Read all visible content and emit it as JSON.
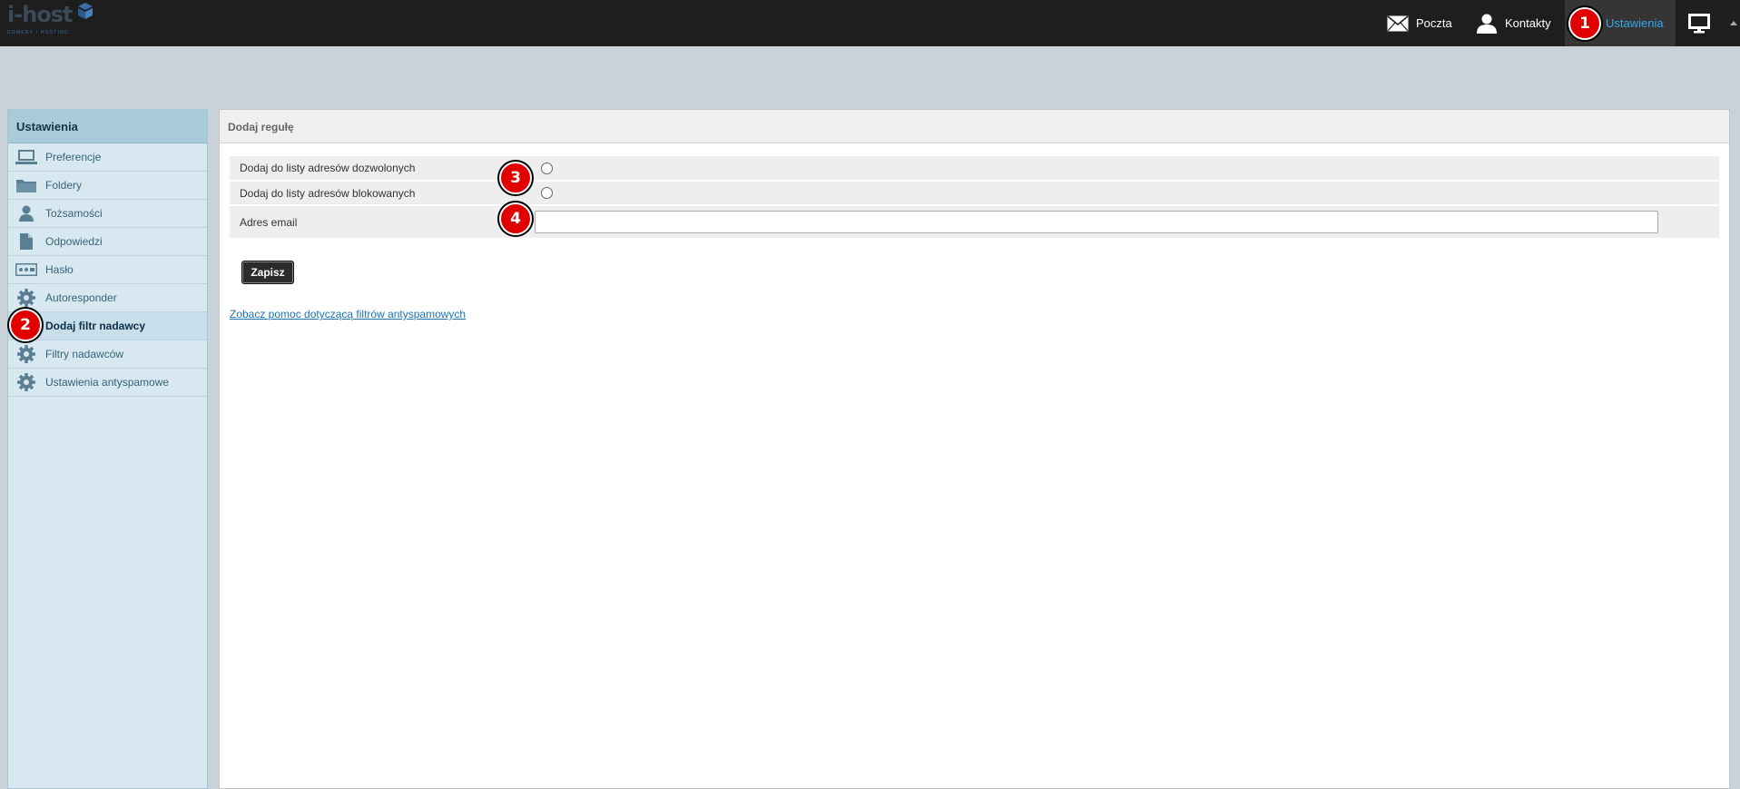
{
  "brand": {
    "name": "i-host",
    "tagline": "DOMENY I HOSTING",
    "color": "#3a6ea5"
  },
  "topbar": {
    "items": [
      {
        "label": "Poczta",
        "icon": "envelope-icon"
      },
      {
        "label": "Kontakty",
        "icon": "person-icon"
      },
      {
        "label": "Ustawienia",
        "icon": "gear-icon",
        "active": true
      },
      {
        "label": "",
        "icon": "monitor-icon"
      }
    ],
    "active_color": "#37a6ea"
  },
  "sidebar": {
    "title": "Ustawienia",
    "items": [
      {
        "label": "Preferencje",
        "icon": "laptop-icon"
      },
      {
        "label": "Foldery",
        "icon": "folder-icon"
      },
      {
        "label": "Tożsamości",
        "icon": "person-icon"
      },
      {
        "label": "Odpowiedzi",
        "icon": "document-icon"
      },
      {
        "label": "Hasło",
        "icon": "password-icon"
      },
      {
        "label": "Autoresponder",
        "icon": "gear-icon"
      },
      {
        "label": "Dodaj filtr nadawcy",
        "icon": "gear-icon",
        "active": true
      },
      {
        "label": "Filtry nadawców",
        "icon": "gear-icon"
      },
      {
        "label": "Ustawienia antyspamowe",
        "icon": "gear-icon"
      }
    ]
  },
  "main": {
    "title": "Dodaj regułę",
    "fields": {
      "whitelist_label": "Dodaj do listy adresów dozwolonych",
      "blacklist_label": "Dodaj do listy adresów blokowanych",
      "email_label": "Adres email",
      "email_value": ""
    },
    "save_label": "Zapisz",
    "help_link": "Zobacz pomoc dotyczącą filtrów antyspamowych"
  },
  "annotations": [
    "1",
    "2",
    "3",
    "4"
  ],
  "colors": {
    "badge": "#e00000",
    "topbar": "#1e1e1e",
    "sidebar": "#d7e8f1",
    "link": "#1a74b7"
  }
}
